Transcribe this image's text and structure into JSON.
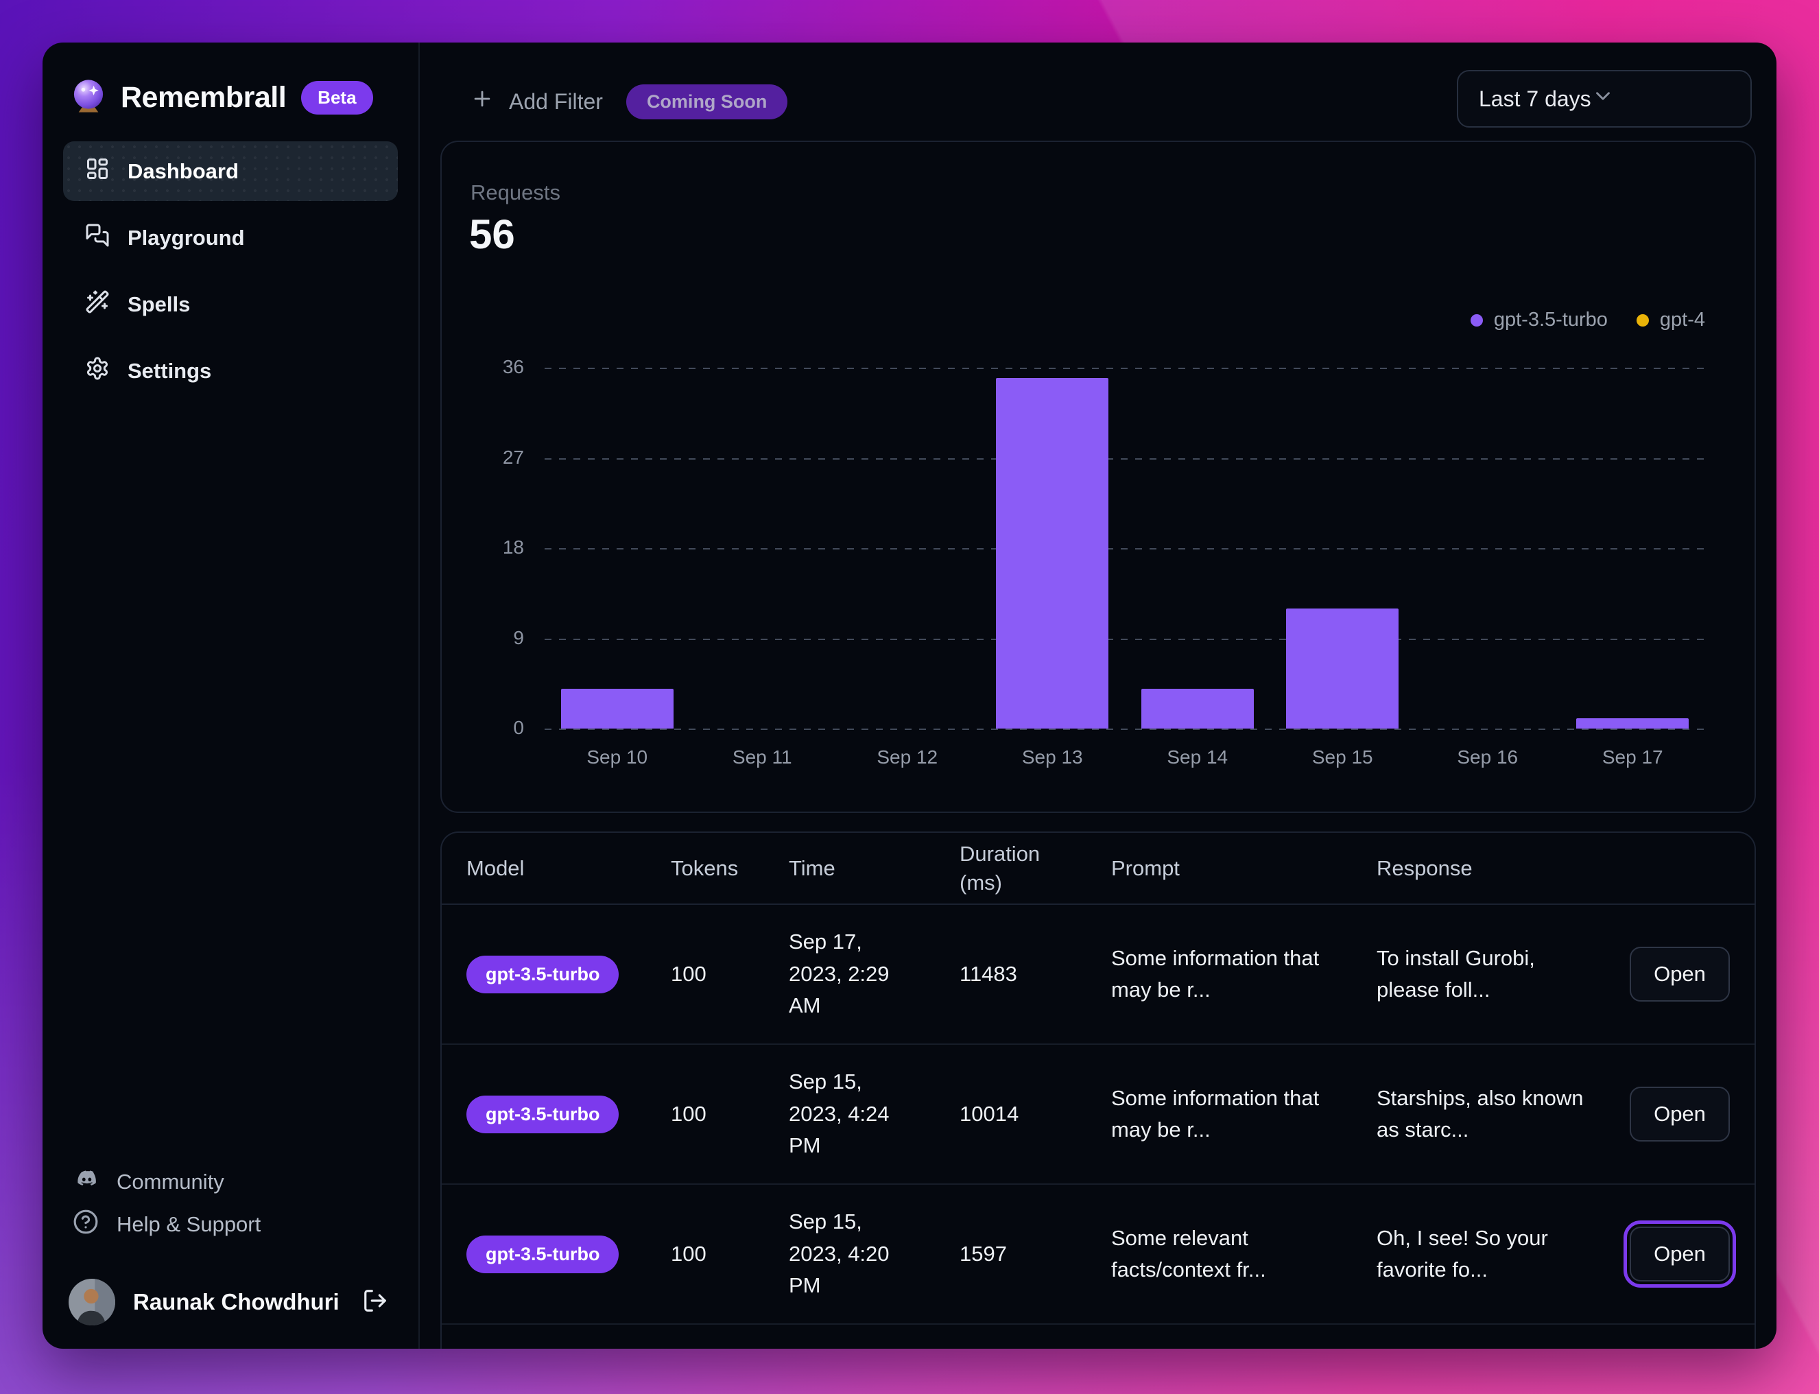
{
  "app": {
    "name": "Remembrall",
    "badge": "Beta"
  },
  "sidebar": {
    "items": [
      {
        "label": "Dashboard",
        "icon": "dashboard-grid-icon",
        "active": true
      },
      {
        "label": "Playground",
        "icon": "chat-bubbles-icon",
        "active": false
      },
      {
        "label": "Spells",
        "icon": "magic-wand-icon",
        "active": false
      },
      {
        "label": "Settings",
        "icon": "gear-icon",
        "active": false
      }
    ],
    "footer_items": [
      {
        "label": "Community",
        "icon": "discord-icon"
      },
      {
        "label": "Help & Support",
        "icon": "help-circle-icon"
      }
    ],
    "user": {
      "name": "Raunak Chowdhuri"
    }
  },
  "topbar": {
    "add_filter_label": "Add Filter",
    "coming_soon_label": "Coming Soon",
    "date_range_value": "Last 7 days"
  },
  "stats": {
    "requests_label": "Requests",
    "requests_value": "56"
  },
  "chart_data": {
    "type": "bar",
    "title": "Requests",
    "total": 56,
    "categories": [
      "Sep 10",
      "Sep 11",
      "Sep 12",
      "Sep 13",
      "Sep 14",
      "Sep 15",
      "Sep 16",
      "Sep 17"
    ],
    "series": [
      {
        "name": "gpt-3.5-turbo",
        "color": "#8B5CF6",
        "values": [
          4,
          0,
          0,
          35,
          4,
          12,
          0,
          1
        ]
      },
      {
        "name": "gpt-4",
        "color": "#EAB308",
        "values": [
          0,
          0,
          0,
          0,
          0,
          0,
          0,
          0
        ]
      }
    ],
    "ylim": [
      0,
      36
    ],
    "yticks": [
      0,
      9,
      18,
      27,
      36
    ],
    "grid": "dashed-horizontal",
    "legend_position": "top-right"
  },
  "table": {
    "headers": [
      "Model",
      "Tokens",
      "Time",
      "Duration (ms)",
      "Prompt",
      "Response"
    ],
    "open_label": "Open",
    "rows": [
      {
        "model": "gpt-3.5-turbo",
        "tokens": "100",
        "time": "Sep 17, 2023, 2:29 AM",
        "duration": "11483",
        "prompt": "Some information that may be r...",
        "response": "To install Gurobi, please foll...",
        "open_focused": false
      },
      {
        "model": "gpt-3.5-turbo",
        "tokens": "100",
        "time": "Sep 15, 2023, 4:24 PM",
        "duration": "10014",
        "prompt": "Some information that may be r...",
        "response": "Starships, also known as starc...",
        "open_focused": false
      },
      {
        "model": "gpt-3.5-turbo",
        "tokens": "100",
        "time": "Sep 15, 2023, 4:20 PM",
        "duration": "1597",
        "prompt": "Some relevant facts/context fr...",
        "response": "Oh, I see! So your favorite fo...",
        "open_focused": true
      }
    ]
  },
  "colors": {
    "accent": "#8B5CF6",
    "badge": "#7C3AED",
    "gpt4_dot": "#EAB308"
  }
}
